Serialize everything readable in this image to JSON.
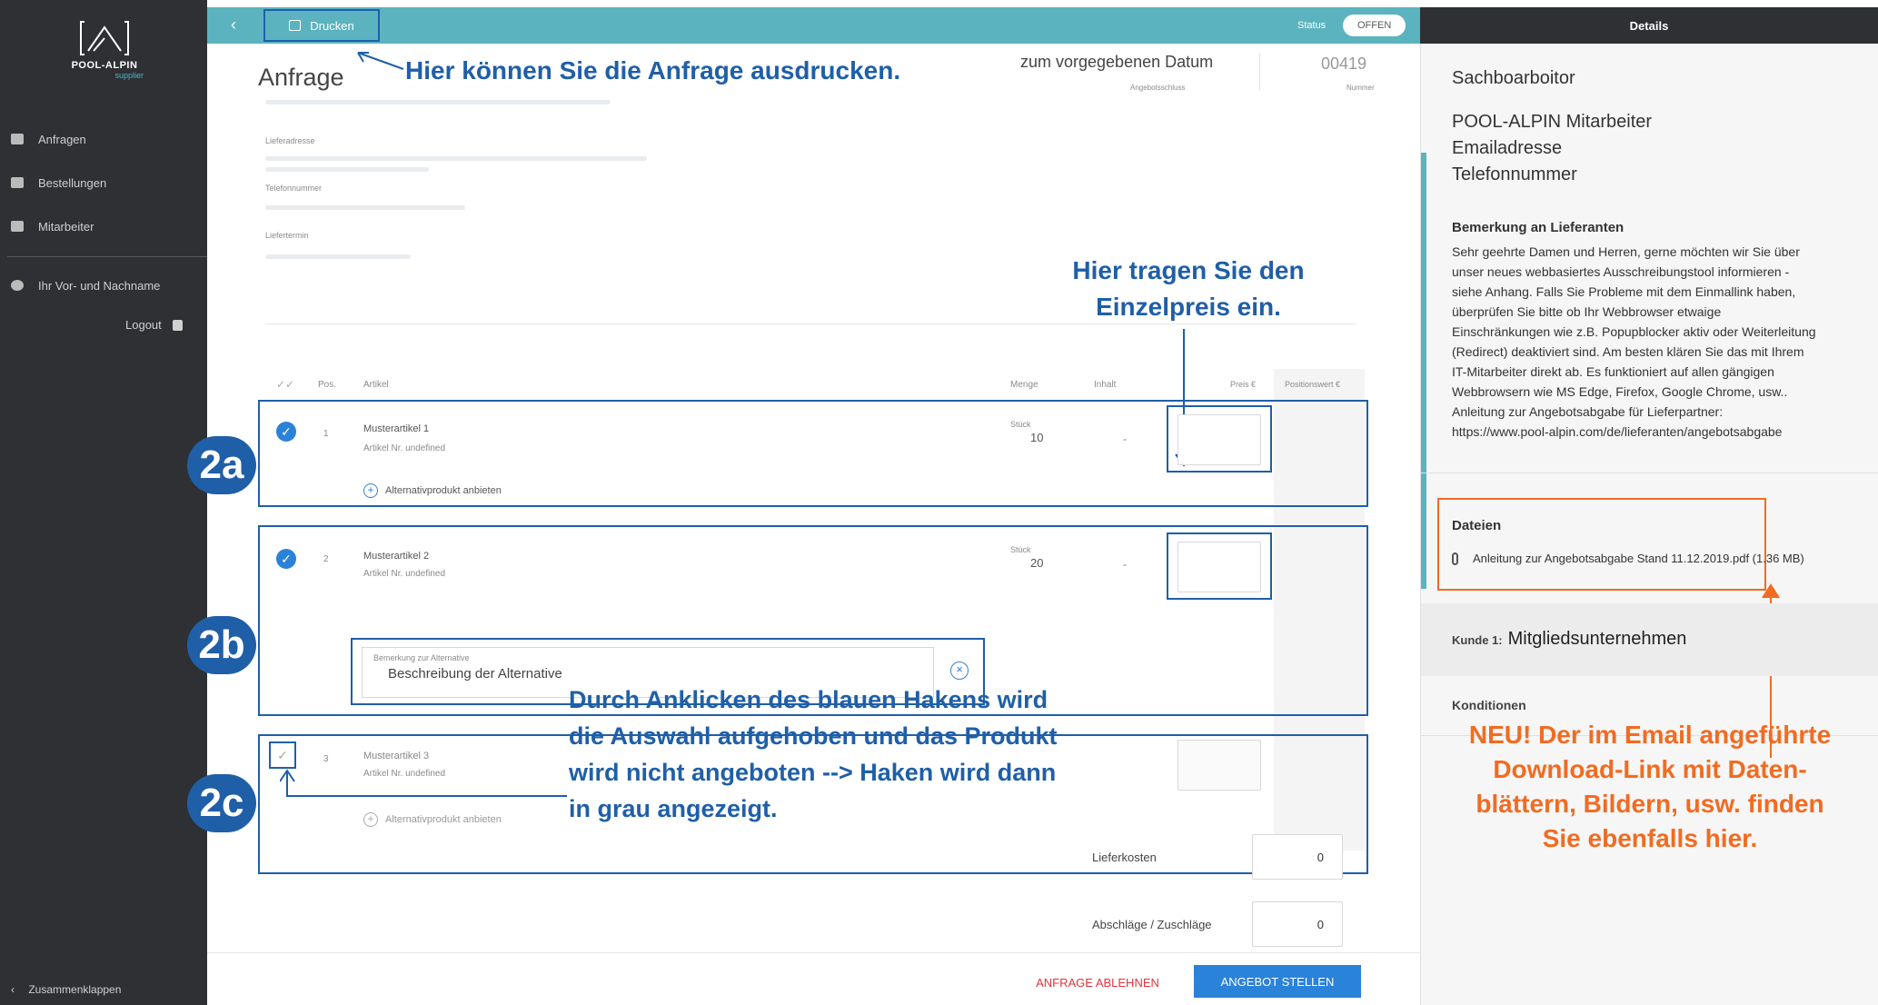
{
  "sidebar": {
    "logo_text": "POOL-ALPIN",
    "logo_sub": "supplier",
    "items": [
      {
        "label": "Anfragen",
        "icon": "truck-icon"
      },
      {
        "label": "Bestellungen",
        "icon": "order-icon"
      },
      {
        "label": "Mitarbeiter",
        "icon": "id-card-icon"
      }
    ],
    "user_name": "Ihr Vor- und Nachname",
    "logout": "Logout",
    "collapse": "Zusammenklappen"
  },
  "topbar": {
    "back": "‹",
    "print": "Drucken",
    "status_label": "Status",
    "status_value": "OFFEN"
  },
  "details_header": "Details",
  "request": {
    "title": "Anfrage",
    "date_text": "zum vorgegebenen Datum",
    "date_label": "Angebotsschluss",
    "number": "00419",
    "number_label": "Nummer",
    "fields": [
      "Lieferadresse",
      "Telefonnummer",
      "Liefertermin"
    ]
  },
  "table": {
    "headers": {
      "pos": "Pos.",
      "artikel": "Artikel",
      "menge": "Menge",
      "inhalt": "Inhalt",
      "preis": "Preis €",
      "positionswert": "Positionswert €"
    },
    "items": [
      {
        "pos": "1",
        "name": "Musterartikel 1",
        "nr": "Artikel Nr. undefined",
        "unit": "Stück",
        "qty": "10",
        "inhalt": "-",
        "alt": "Alternativprodukt anbieten"
      },
      {
        "pos": "2",
        "name": "Musterartikel 2",
        "nr": "Artikel Nr. undefined",
        "unit": "Stück",
        "qty": "20",
        "inhalt": "-",
        "alt_label": "Bemerkung zur Alternative",
        "alt_value": "Beschreibung der Alternative"
      },
      {
        "pos": "3",
        "name": "Musterartikel 3",
        "nr": "Artikel Nr. undefined",
        "alt": "Alternativprodukt anbieten"
      }
    ]
  },
  "totals": {
    "lieferkosten_label": "Lieferkosten",
    "lieferkosten_value": "0",
    "abschlaege_label": "Abschläge / Zuschläge",
    "abschlaege_value": "0"
  },
  "actions": {
    "decline": "ANFRAGE ABLEHNEN",
    "submit": "ANGEBOT STELLEN"
  },
  "annotations": {
    "print": "Hier können Sie die Anfrage ausdrucken.",
    "price_line1": "Hier tragen Sie den",
    "price_line2": "Einzelpreis ein.",
    "badge_a": "2a",
    "badge_b": "2b",
    "badge_c": "2c",
    "check_lines": [
      "Durch Anklicken des blauen Hakens wird",
      "die Auswahl aufgehoben und das Produkt",
      "wird nicht angeboten --> Haken wird dann",
      "in grau angezeigt."
    ],
    "neu_lines": [
      "NEU! Der im Email angeführte",
      "Download-Link mit Daten-",
      "blättern, Bildern, usw. finden",
      "Sie ebenfalls hier."
    ]
  },
  "details": {
    "sachbearbeiter": "Sachboarboitor",
    "contact": [
      "POOL-ALPIN Mitarbeiter",
      "Emailadresse",
      "Telefonnummer"
    ],
    "remark_head": "Bemerkung an Lieferanten",
    "remark_lines": [
      "Sehr geehrte Damen und Herren, gerne möchten wir Sie über",
      "unser neues webbasiertes Ausschreibungstool informieren -",
      "siehe Anhang. Falls Sie Probleme mit dem Einmallink haben,",
      "überprüfen Sie bitte ob Ihr Webbrowser etwaige",
      "Einschränkungen wie z.B. Popupblocker aktiv oder Weiterleitung",
      "(Redirect) deaktiviert sind. Am besten klären Sie das mit Ihrem",
      "IT-Mitarbeiter direkt ab. Es funktioniert auf allen gängigen",
      "Webbrowsern wie MS Edge, Firefox, Google Chrome, usw..",
      "Anleitung zur Angebotsabgabe für Lieferpartner:",
      "https://www.pool-alpin.com/de/lieferanten/angebotsabgabe"
    ],
    "files_head": "Dateien",
    "file_name": "Anleitung zur Angebotsabgabe Stand 11.12.2019.pdf (1.36 MB)",
    "kunde_label": "Kunde 1:",
    "kunde_value": "Mitgliedsunternehmen",
    "konditionen": "Konditionen"
  }
}
